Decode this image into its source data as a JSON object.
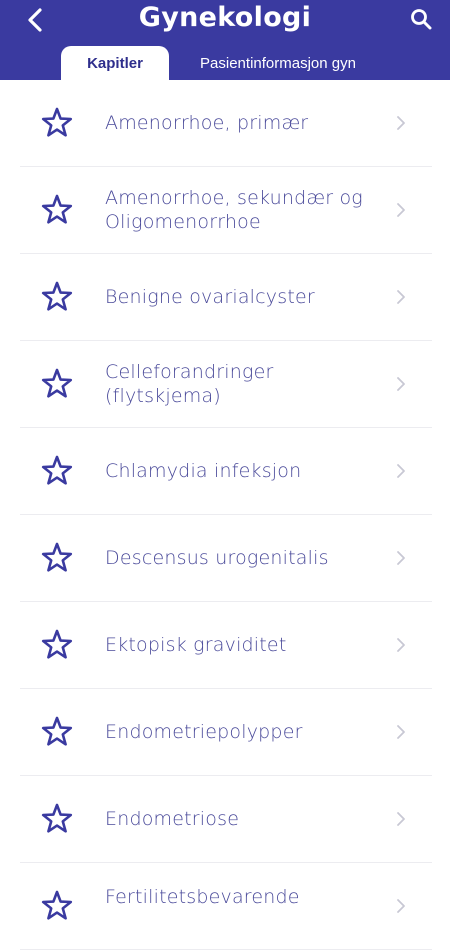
{
  "header": {
    "title": "Gynekologi",
    "tabs": [
      {
        "label": "Kapitler",
        "active": true
      },
      {
        "label": "Pasientinformasjon gyn",
        "active": false
      }
    ]
  },
  "colors": {
    "header_bg": "#3a3aa0",
    "accent": "#3a3aa0",
    "item_text": "#4a4a9a",
    "chevron": "#c8c8d4"
  },
  "icons": {
    "back": "chevron-left-icon",
    "search": "search-icon",
    "favorite": "star-outline-icon",
    "row_arrow": "chevron-right-icon"
  },
  "chapters": [
    {
      "label": "Amenorrhoe, primær"
    },
    {
      "label": "Amenorrhoe, sekundær og Oligomenorrhoe"
    },
    {
      "label": "Benigne ovarialcyster"
    },
    {
      "label": "Celleforandringer (flytskjema)"
    },
    {
      "label": "Chlamydia infeksjon"
    },
    {
      "label": "Descensus urogenitalis"
    },
    {
      "label": "Ektopisk graviditet"
    },
    {
      "label": "Endometriepolypper"
    },
    {
      "label": "Endometriose"
    },
    {
      "label": "Fertilitetsbevarende"
    }
  ]
}
